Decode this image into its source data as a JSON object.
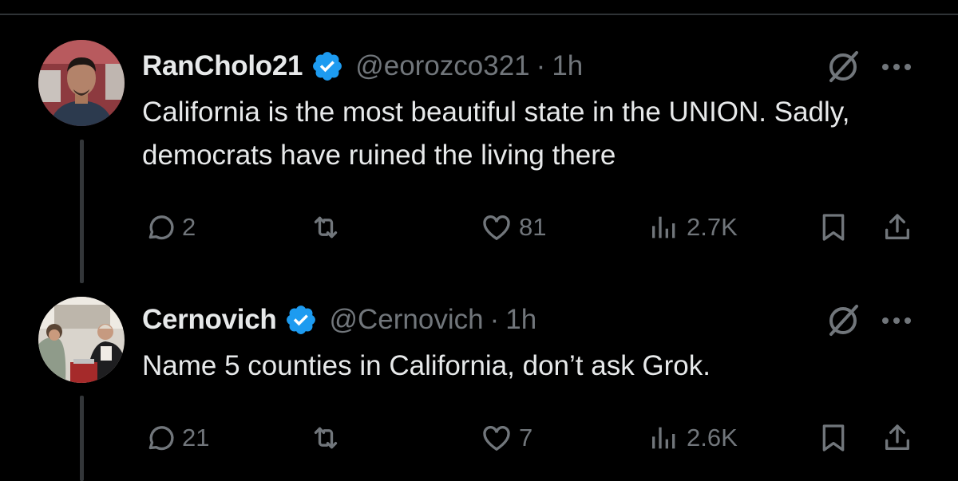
{
  "colors": {
    "background": "#000000",
    "primary_text": "#e7e9ea",
    "secondary_text": "#71767b",
    "verified_blue": "#1d9bf0",
    "divider": "#2f3336"
  },
  "tweets": [
    {
      "name": "RanCholo21",
      "handle": "@eorozco321",
      "separator": "·",
      "time": "1h",
      "text": "California is the most beautiful state in the UNION. Sadly, democrats have ruined the living there",
      "replies": "2",
      "likes": "81",
      "views": "2.7K"
    },
    {
      "name": "Cernovich",
      "handle": "@Cernovich",
      "separator": "·",
      "time": "1h",
      "text": "Name 5 counties in California, don’t ask Grok.",
      "replies": "21",
      "likes": "7",
      "views": "2.6K"
    }
  ]
}
